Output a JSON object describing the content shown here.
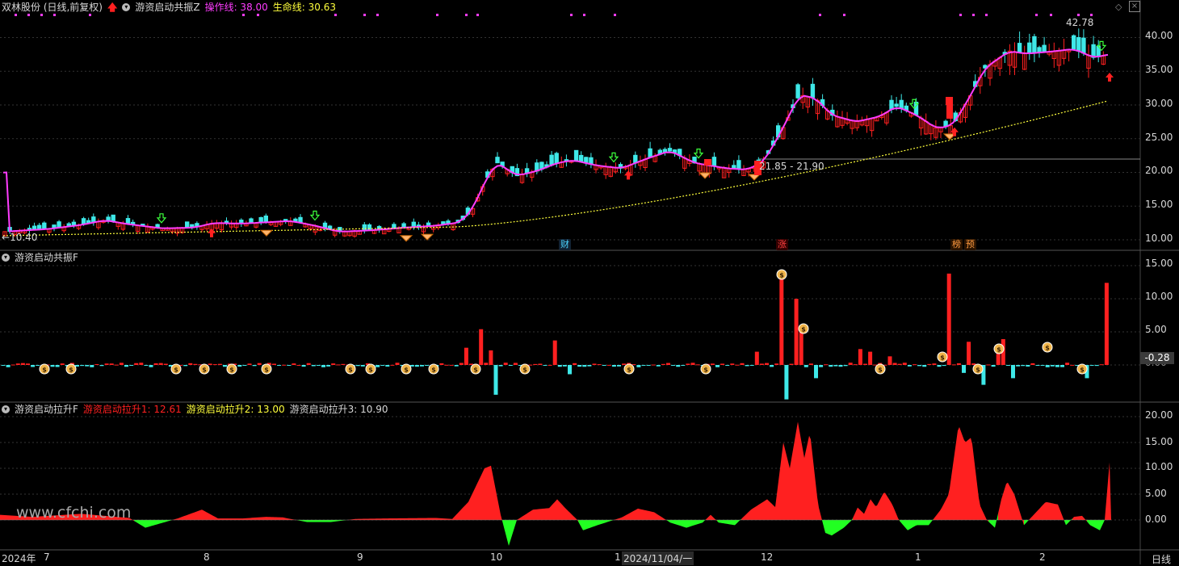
{
  "main": {
    "stock": "双林股份 (日线,前复权)",
    "indicator": "游资启动共振Z",
    "op_label": "操作线: 38.00",
    "life_label": "生命线: 30.63",
    "yticks": [
      "40.00",
      "35.00",
      "30.00",
      "25.00",
      "20.00",
      "15.00",
      "10.00"
    ],
    "max_label": "42.78",
    "min_label": "10.40",
    "range_label": "21.85 - 21.90",
    "badges": [
      "财",
      "涨",
      "榜",
      "预"
    ],
    "colors": {
      "up": "#ff2020",
      "down": "#3ee8e8",
      "op": "#ff3cff",
      "life": "#ffff3c"
    }
  },
  "panel2": {
    "title": "游资启动共振F",
    "yticks": [
      "15.00",
      "10.00",
      "5.00",
      "0.00"
    ],
    "value_box": "-0.28"
  },
  "panel3": {
    "title": "游资启动拉升F",
    "s1": "游资启动拉升1: 12.61",
    "s2": "游资启动拉升2: 13.00",
    "s3": "游资启动拉升3: 10.90",
    "yticks": [
      "20.00",
      "15.00",
      "10.00",
      "5.00",
      "0.00"
    ]
  },
  "xaxis": {
    "labels": [
      "2024年",
      "7",
      "8",
      "9",
      "10",
      "1",
      "2024/11/04/一",
      "12",
      "1",
      "2"
    ],
    "period": "日线"
  },
  "watermark": "www.cfchi.com",
  "chart_data": {
    "type": "candlestick",
    "y_range": [
      9,
      44
    ],
    "op_line_last": 38.0,
    "life_line_last": 30.63,
    "high_max": 42.78,
    "low_min": 10.4
  }
}
